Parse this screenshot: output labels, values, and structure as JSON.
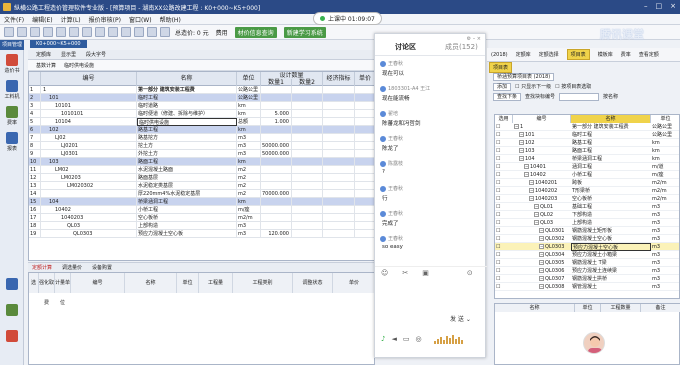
{
  "window": {
    "title": "纵横公路工程造价管理软件专业版 - [预算项目 - 湖南XX公路改建工程 : K0+000~K5+000]"
  },
  "timer": {
    "text": "上课中 01:09:07"
  },
  "brand": {
    "text": "腾讯课堂"
  },
  "menubar": [
    "文件(F)",
    "编辑(E)",
    "计算(L)",
    "报价审核(P)",
    "窗口(W)",
    "帮助(H)"
  ],
  "toolbar": {
    "total_label": "总造价: 0 元",
    "btn1": "材价信息查询",
    "btn2": "新建学习系统",
    "fee": "费用"
  },
  "left_tab": "项目管理",
  "project_tab": "K0+000~K5+000",
  "subtabs": [
    "定额库",
    "显示里",
    "段大字号"
  ],
  "subtool": {
    "add": "基数计算",
    "desc": "临时供电设施"
  },
  "sidebar": [
    {
      "label": "造价书",
      "icon": "book-icon",
      "color": "#d14b3a"
    },
    {
      "label": "工料机",
      "icon": "materials-icon",
      "color": "#3a67b0"
    },
    {
      "label": "费率",
      "icon": "rate-icon",
      "color": "#5a8a3c"
    },
    {
      "label": "报表",
      "icon": "report-icon",
      "color": "#3a67b0"
    }
  ],
  "grid": {
    "headers": {
      "no": "编号",
      "name": "名称",
      "unit": "单位",
      "qty": "设计数量",
      "qty1": "数量1",
      "qty2": "数量2",
      "formula": "经济指标",
      "price": "单价"
    },
    "rows": [
      {
        "idx": "1",
        "code": "1",
        "name": "第一部分 建筑安装工程费",
        "unit": "公路公里",
        "q1": "",
        "q2": "",
        "style": "normal",
        "indent": 0
      },
      {
        "idx": "2",
        "code": "101",
        "name": "临时工程",
        "unit": "公路公里",
        "q1": "",
        "q2": "",
        "style": "blue",
        "indent": 1
      },
      {
        "idx": "3",
        "code": "10101",
        "name": "临时道路",
        "unit": "km",
        "q1": "",
        "q2": "",
        "style": "normal",
        "indent": 2
      },
      {
        "idx": "4",
        "code": "1010101",
        "name": "临时便道（修建、拆除与维护）",
        "unit": "km",
        "q1": "5.000",
        "q2": "",
        "style": "normal",
        "indent": 3
      },
      {
        "idx": "5",
        "code": "10104",
        "name": "临时供电设施",
        "unit": "总额",
        "q1": "1.000",
        "q2": "",
        "style": "sel",
        "indent": 2
      },
      {
        "idx": "6",
        "code": "102",
        "name": "路基工程",
        "unit": "km",
        "q1": "",
        "q2": "",
        "style": "blue",
        "indent": 1
      },
      {
        "idx": "7",
        "code": "LJ02",
        "name": "路基挖方",
        "unit": "m3",
        "q1": "",
        "q2": "",
        "style": "normal",
        "indent": 2
      },
      {
        "idx": "8",
        "code": "LJ0201",
        "name": "挖土方",
        "unit": "m3",
        "q1": "50000.000",
        "q2": "",
        "style": "normal",
        "indent": 3
      },
      {
        "idx": "9",
        "code": "LJ0301",
        "name": "外挖土方",
        "unit": "m3",
        "q1": "50000.000",
        "q2": "",
        "style": "normal",
        "indent": 3
      },
      {
        "idx": "10",
        "code": "103",
        "name": "路面工程",
        "unit": "km",
        "q1": "",
        "q2": "",
        "style": "blue",
        "indent": 1
      },
      {
        "idx": "11",
        "code": "LM02",
        "name": "水泥混凝土路面",
        "unit": "m2",
        "q1": "",
        "q2": "",
        "style": "normal",
        "indent": 2
      },
      {
        "idx": "12",
        "code": "LM0203",
        "name": "路面基层",
        "unit": "m2",
        "q1": "",
        "q2": "",
        "style": "normal",
        "indent": 3
      },
      {
        "idx": "13",
        "code": "LM020302",
        "name": "水泥稳定类基层",
        "unit": "m2",
        "q1": "",
        "q2": "",
        "style": "normal",
        "indent": 4
      },
      {
        "idx": "14",
        "code": "",
        "name": "厚220mm4%水泥稳定基层",
        "unit": "m2",
        "q1": "70000.000",
        "q2": "",
        "style": "normal",
        "indent": 4
      },
      {
        "idx": "15",
        "code": "104",
        "name": "桥梁涵洞工程",
        "unit": "km",
        "q1": "",
        "q2": "",
        "style": "blue",
        "indent": 1
      },
      {
        "idx": "16",
        "code": "10402",
        "name": "小桥工程",
        "unit": "m/座",
        "q1": "",
        "q2": "",
        "style": "normal",
        "indent": 2
      },
      {
        "idx": "17",
        "code": "1040203",
        "name": "空心板桥",
        "unit": "m2/m",
        "q1": "",
        "q2": "",
        "style": "normal",
        "indent": 3
      },
      {
        "idx": "18",
        "code": "QL03",
        "name": "上部构造",
        "unit": "m3",
        "q1": "",
        "q2": "",
        "style": "normal",
        "indent": 4
      },
      {
        "idx": "19",
        "code": "QL0303",
        "name": "预应力混凝土空心板",
        "unit": "m3",
        "q1": "120.000",
        "q2": "",
        "style": "normal",
        "indent": 5
      }
    ]
  },
  "bottom_tabs": [
    "定额计算",
    "调选量价",
    "设备购置"
  ],
  "bottom_grid": {
    "headers": [
      "选",
      "强化取费",
      "计量单位",
      "编号",
      "名称",
      "单位",
      "工程量",
      "工程类别",
      "调整状态",
      "单价"
    ]
  },
  "chat": {
    "tab_discussion": "讨论区",
    "tab_members": "成员(152)",
    "messages": [
      {
        "name": "王春秋",
        "text": "现在可以"
      },
      {
        "name": "1803301-A4 王江",
        "text": "现在能流畅"
      },
      {
        "name": "翟培",
        "text": "陈蕃龙和冯哲剑"
      },
      {
        "name": "王春秋",
        "text": "陈龙了"
      },
      {
        "name": "陈露枝",
        "text": "?"
      },
      {
        "name": "王春秋",
        "text": "行"
      },
      {
        "name": "王春秋",
        "text": "完成了"
      },
      {
        "name": "王春秋",
        "text": "so easy"
      }
    ],
    "send_label": "发 送"
  },
  "right_panel": {
    "top_tabs": [
      "(2018)",
      "定额库",
      "定额选择",
      "项目表",
      "模板库",
      "费率",
      "查看定额"
    ],
    "tool_tab": "项目表",
    "title_line": "桥涵预算项目表 (2018)",
    "add_btn": "添加",
    "chk1": "只显示下一级",
    "chk2": "按项目表选取",
    "search_btn": "查找下条",
    "search_label": "查找块标编号",
    "search_label2": "按名称",
    "headers": {
      "sel": "选用",
      "code": "编号",
      "name": "名称",
      "unit": "单位"
    },
    "rows": [
      {
        "code": "1",
        "name": "第一部分 建筑安装工程费",
        "unit": "公路公里",
        "indent": 0,
        "hl": false
      },
      {
        "code": "101",
        "name": "临时工程",
        "unit": "公路公里",
        "indent": 1,
        "hl": false
      },
      {
        "code": "102",
        "name": "路基工程",
        "unit": "km",
        "indent": 1,
        "hl": false
      },
      {
        "code": "103",
        "name": "路面工程",
        "unit": "km",
        "indent": 1,
        "hl": false
      },
      {
        "code": "104",
        "name": "桥梁涵洞工程",
        "unit": "km",
        "indent": 1,
        "hl": false
      },
      {
        "code": "10401",
        "name": "涵洞工程",
        "unit": "m/道",
        "indent": 2,
        "hl": false
      },
      {
        "code": "10402",
        "name": "小桥工程",
        "unit": "m/座",
        "indent": 2,
        "hl": false
      },
      {
        "code": "1040201",
        "name": "跨板",
        "unit": "m2/m",
        "indent": 3,
        "hl": false
      },
      {
        "code": "1040202",
        "name": "T形梁桥",
        "unit": "m2/m",
        "indent": 3,
        "hl": false
      },
      {
        "code": "1040203",
        "name": "空心板桥",
        "unit": "m2/m",
        "indent": 3,
        "hl": false
      },
      {
        "code": "QL01",
        "name": "基础工程",
        "unit": "m3",
        "indent": 4,
        "hl": false
      },
      {
        "code": "QL02",
        "name": "下部构造",
        "unit": "m3",
        "indent": 4,
        "hl": false
      },
      {
        "code": "QL03",
        "name": "上部构造",
        "unit": "m3",
        "indent": 4,
        "hl": false
      },
      {
        "code": "QL0301",
        "name": "钢筋混凝土矩形板",
        "unit": "m3",
        "indent": 5,
        "hl": false
      },
      {
        "code": "QL0302",
        "name": "钢筋混凝土空心板",
        "unit": "m3",
        "indent": 5,
        "hl": false
      },
      {
        "code": "QL0303",
        "name": "预应力混凝土空心板",
        "unit": "m3",
        "indent": 5,
        "hl": true
      },
      {
        "code": "QL0304",
        "name": "预应力混凝土小箱梁",
        "unit": "m3",
        "indent": 5,
        "hl": false
      },
      {
        "code": "QL0305",
        "name": "钢筋混凝土 T梁",
        "unit": "m3",
        "indent": 5,
        "hl": false
      },
      {
        "code": "QL0306",
        "name": "预应力混凝土连续梁",
        "unit": "m3",
        "indent": 5,
        "hl": false
      },
      {
        "code": "QL0307",
        "name": "钢筋混凝土拱桥",
        "unit": "m3",
        "indent": 5,
        "hl": false
      },
      {
        "code": "QL0308",
        "name": "钢管混凝土",
        "unit": "m3",
        "indent": 5,
        "hl": false
      }
    ],
    "bottom_headers": [
      "名称",
      "单位",
      "工程数量",
      "备注"
    ]
  }
}
